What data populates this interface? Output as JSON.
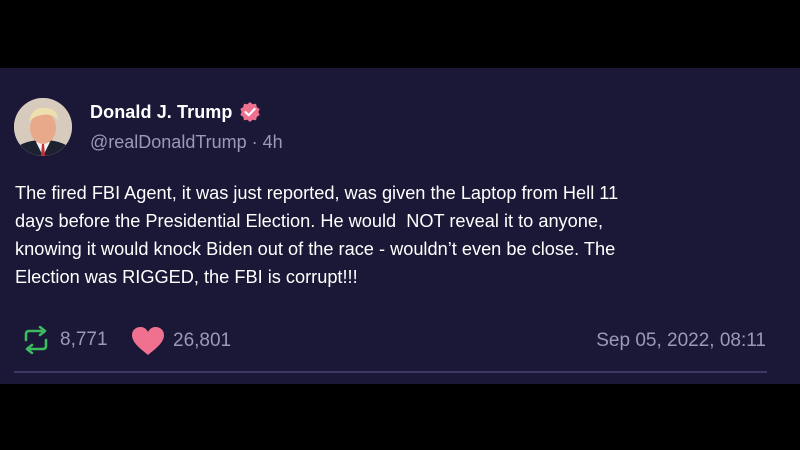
{
  "tweet": {
    "display_name": "Donald J. Trump",
    "verified": true,
    "handle": "@realDonaldTrump",
    "separator": " · ",
    "age": "4h",
    "text": "The fired FBI Agent, it was just reported, was given the Laptop from Hell 11\ndays before the Presidential Election. He would  NOT reveal it to anyone,\nknowing it would knock Biden out of the race - wouldn’t even be close. The\nElection was RIGGED, the FBI is corrupt!!!",
    "retweets": "8,771",
    "likes": "26,801",
    "timestamp": "Sep 05, 2022, 08:11"
  },
  "icons": {
    "verified": "verified-badge-icon",
    "retweet": "retweet-icon",
    "like": "heart-icon"
  },
  "colors": {
    "background": "#000000",
    "card": "#1a1836",
    "text": "#ffffff",
    "muted": "#9b99b5",
    "retweet": "#3dbb5e",
    "like": "#f0718f",
    "verified": "#f0718f"
  }
}
